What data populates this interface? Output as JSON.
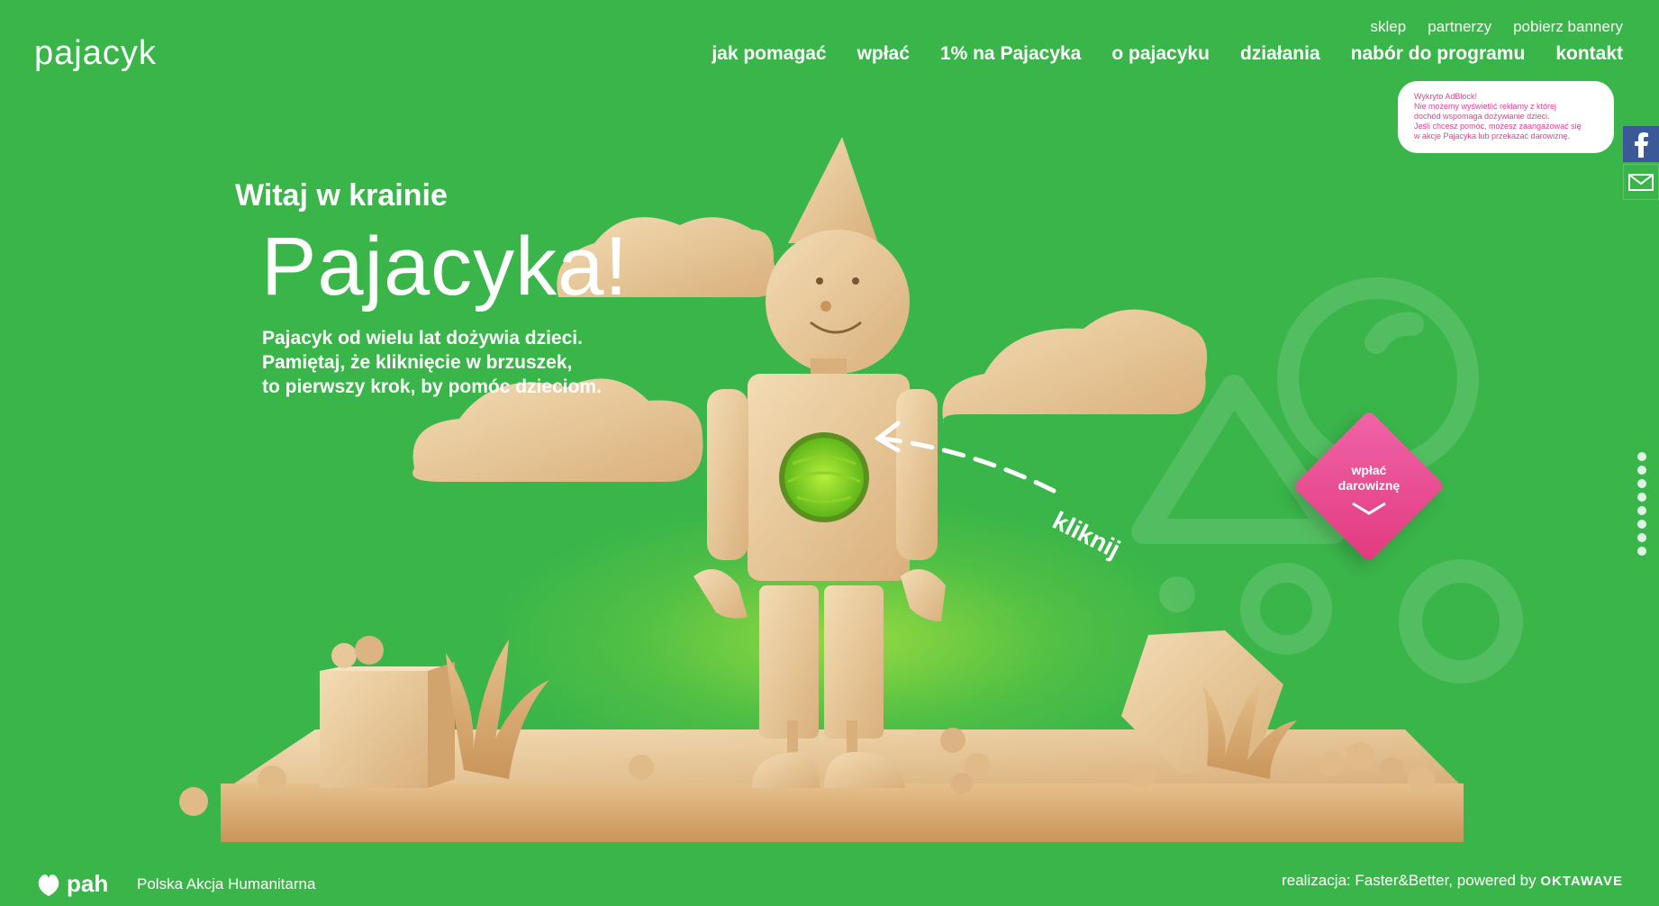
{
  "logo": {
    "text": "pajacyk"
  },
  "top_links": [
    "sklep",
    "partnerzy",
    "pobierz bannery"
  ],
  "main_nav": [
    "jak pomagać",
    "wpłać",
    "1% na Pajacyka",
    "o pajacyku",
    "działania",
    "nabór do programu",
    "kontakt"
  ],
  "adblock_notice": {
    "lines": [
      "Wykryto AdBlock!",
      "Nie możemy wyświetlić reklamy z której",
      "dochód wspomaga dożywianie dzieci.",
      "Jeśli chcesz pomóc, możesz zaangażować się",
      "w akcje Pajacyka lub przekazać darowiznę."
    ]
  },
  "share": {
    "facebook_icon": "facebook-icon",
    "mail_icon": "mail-icon"
  },
  "hero": {
    "subtitle": "Witaj w krainie",
    "title": "Pajacyka!",
    "description": [
      "Pajacyk od wielu lat dożywia dzieci.",
      "Pamiętaj, że kliknięcie w brzuszek,",
      "to pierwszy krok, by pomóc dzieciom."
    ]
  },
  "click_hint": "kliknij",
  "donate": {
    "label_1": "wpłać",
    "label_2": "darowiznę"
  },
  "footer": {
    "pah_logo": "pah",
    "pah_name": "Polska Akcja Humanitarna",
    "credits": "realizacja: Faster&Better, powered by",
    "powered_logo": "OKTAWAVE"
  },
  "colors": {
    "background": "#3ab54a",
    "accent_pink": "#e53d8f",
    "wood": "#e8c89a"
  }
}
